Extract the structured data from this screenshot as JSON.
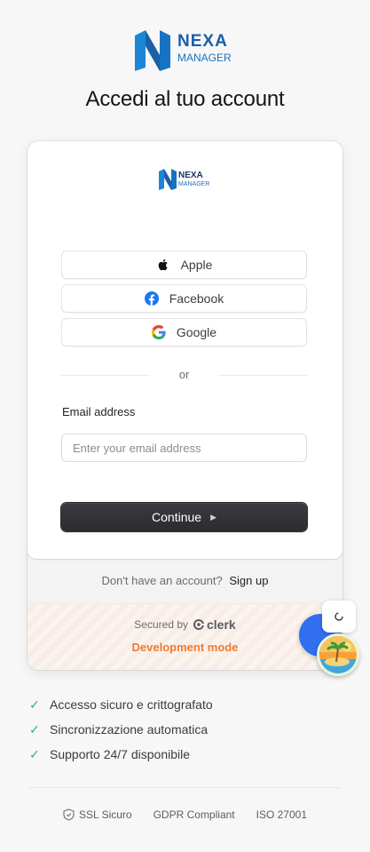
{
  "brand": {
    "logo_top": "NEXA",
    "logo_bottom": "MANAGER",
    "colors": {
      "blue": "#1a7fd6",
      "dark": "#17365f"
    }
  },
  "page": {
    "title": "Accedi al tuo account"
  },
  "auth": {
    "social": [
      {
        "label": "Apple",
        "icon": "apple-icon"
      },
      {
        "label": "Facebook",
        "icon": "facebook-icon"
      },
      {
        "label": "Google",
        "icon": "google-icon"
      }
    ],
    "divider": "or",
    "email_label": "Email address",
    "email_placeholder": "Enter your email address",
    "email_value": "",
    "continue_label": "Continue",
    "signup_prompt": "Don't have an account?",
    "signup_link": "Sign up",
    "secured_by": "Secured by",
    "clerk": "clerk",
    "dev_mode": "Development mode"
  },
  "features": [
    "Accesso sicuro e crittografato",
    "Sincronizzazione automatica",
    "Supporto 24/7 disponibile"
  ],
  "footer": {
    "ssl": "SSL Sicuro",
    "gdpr": "GDPR Compliant",
    "iso": "ISO 27001"
  },
  "colors": {
    "accent_orange": "#f07a2e",
    "check_green": "#37b36a",
    "button_dark": "#2f3034",
    "floating_blue": "#2f6ff0"
  }
}
